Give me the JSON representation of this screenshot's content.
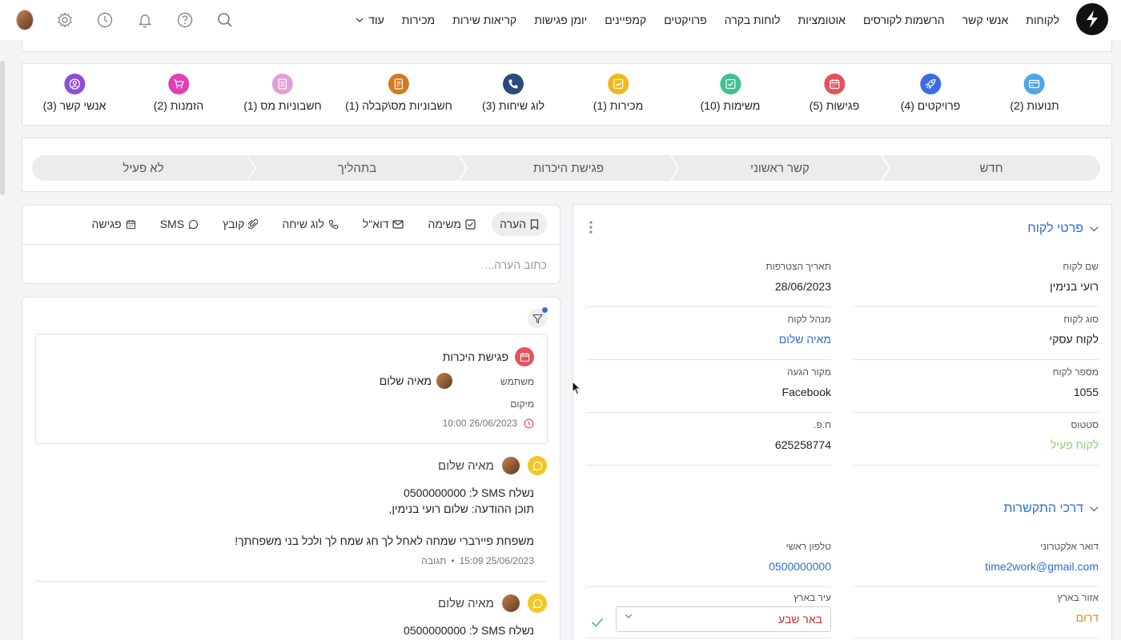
{
  "nav": {
    "items": [
      "לקוחות",
      "אנשי קשר",
      "הרשמות לקורסים",
      "אוטומציות",
      "לוחות בקרה",
      "פרויקטים",
      "קמפיינים",
      "יומן פגישות",
      "קריאות שירות",
      "מכירות"
    ],
    "more": "עוד"
  },
  "counters": [
    {
      "label": "אנשי קשר (3)",
      "color": "#8b4fd9",
      "icon": "contact-icon"
    },
    {
      "label": "הזמנות (2)",
      "color": "#e03fb6",
      "icon": "cart-icon"
    },
    {
      "label": "חשבוניות מס (1)",
      "color": "#e2a0d9",
      "icon": "invoice-icon"
    },
    {
      "label": "חשבוניות מס\\קבלה (1)",
      "color": "#d47a1e",
      "icon": "receipt-icon"
    },
    {
      "label": "לוג שיחות (3)",
      "color": "#2b4a7e",
      "icon": "phone-icon"
    },
    {
      "label": "מכירות (1)",
      "color": "#f0b818",
      "icon": "chart-icon"
    },
    {
      "label": "משימות (10)",
      "color": "#3fc28b",
      "icon": "check-icon"
    },
    {
      "label": "פגישות (5)",
      "color": "#e94f5c",
      "icon": "calendar-icon"
    },
    {
      "label": "פרויקטים (4)",
      "color": "#3a6de0",
      "icon": "rocket-icon"
    },
    {
      "label": "תנועות (2)",
      "color": "#4fa7e6",
      "icon": "card-icon"
    }
  ],
  "stages": [
    "חדש",
    "קשר ראשוני",
    "פגישת היכרות",
    "בתהליך",
    "לא פעיל"
  ],
  "details": {
    "title": "פרטי לקוח",
    "fields": {
      "name_label": "שם לקוח",
      "name": "רועי בנימין",
      "join_label": "תאריך הצטרפות",
      "join": "28/06/2023",
      "type_label": "סוג לקוח",
      "type": "לקוח עסקי",
      "manager_label": "מנהל לקוח",
      "manager": "מאיה שלום",
      "number_label": "מספר לקוח",
      "number": "1055",
      "source_label": "מקור הגעה",
      "source": "Facebook",
      "status_label": "סטטוס",
      "status": "לקוח פעיל",
      "hp_label": "ח.פ.",
      "hp": "625258774"
    },
    "contact_title": "דרכי התקשרות",
    "contact": {
      "email_label": "דואר אלקטרוני",
      "email": "time2work@gmail.com",
      "phone_label": "טלפון ראשי",
      "phone": "0500000000",
      "region_label": "אזור בארץ",
      "region": "דרום",
      "city_label": "עיר בארץ",
      "city": "באר שבע"
    }
  },
  "composer": {
    "tabs": [
      {
        "label": "הערה",
        "icon": "bookmark-icon"
      },
      {
        "label": "משימה",
        "icon": "checkbox-icon"
      },
      {
        "label": "דוא\"ל",
        "icon": "mail-icon"
      },
      {
        "label": "לוג שיחה",
        "icon": "phone-icon"
      },
      {
        "label": "קובץ",
        "icon": "paperclip-icon"
      },
      {
        "label": "SMS",
        "icon": "chat-icon"
      },
      {
        "label": "פגישה",
        "icon": "calendar-icon"
      }
    ],
    "placeholder": "כתוב הערה..."
  },
  "feed": {
    "meeting": {
      "title": "פגישת היכרות",
      "user_label": "משתמש",
      "user": "מאיה שלום",
      "location_label": "מיקום",
      "time": "26/06/2023 10:00"
    },
    "sms1": {
      "author": "מאיה שלום",
      "body": "נשלח SMS ל: 0500000000\nתוכן ההודעה: שלום  רועי בנימין,\n\nמשפחת פיירברי שמחה לאחל לך חג שמח לך ולכל בני משפחתך!",
      "time": "25/06/2023 15:09",
      "reply": "תגובה"
    },
    "sms2": {
      "author": "מאיה שלום",
      "body": "נשלח SMS ל: 0500000000"
    }
  }
}
